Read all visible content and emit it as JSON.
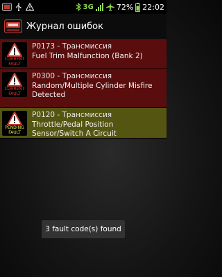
{
  "statusbar": {
    "network": "3G",
    "battery": "72%",
    "time": "22:02"
  },
  "header": {
    "title": "Журнал ошибок"
  },
  "faults": [
    {
      "code_line": "P0173 - Трансмиссия",
      "description": "Fuel Trim Malfunction (Bank 2)",
      "badge_line1": "CURRENT",
      "badge_line2": "FAULT",
      "status": "current"
    },
    {
      "code_line": "P0300 - Трансмиссия",
      "description": "Random/Multiple Cylinder Misfire Detected",
      "badge_line1": "CURRENT",
      "badge_line2": "FAULT",
      "status": "current"
    },
    {
      "code_line": "P0120 - Трансмиссия",
      "description": "Throttle/Pedal Position Sensor/Switch A Circuit",
      "badge_line1": "PENDING",
      "badge_line2": "FAULT",
      "status": "pending"
    }
  ],
  "toast": {
    "message": "3 fault code(s) found"
  },
  "colors": {
    "current_row": "#5a0d0d",
    "pending_row": "#555512",
    "status_icons": "#8fd84a"
  },
  "icons": [
    "app-notification-icon",
    "usb-icon",
    "warning-icon",
    "bluetooth-icon",
    "signal-icon",
    "airplane-icon",
    "battery-icon",
    "warning-triangle-icon"
  ]
}
